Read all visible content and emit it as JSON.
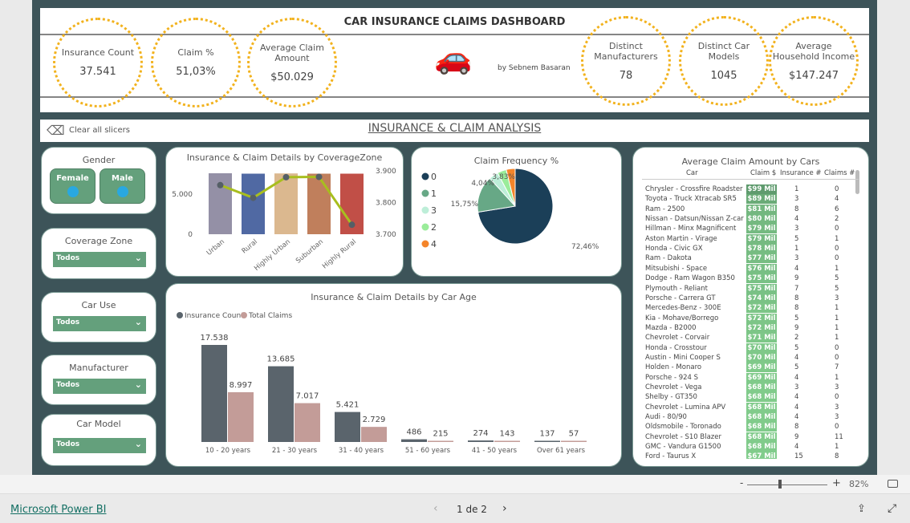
{
  "header": {
    "title": "CAR INSURANCE CLAIMS DASHBOARD",
    "author": "by Sebnem Basaran"
  },
  "kpis": [
    {
      "label": "Insurance Count",
      "value": "37.541"
    },
    {
      "label": "Claim %",
      "value": "51,03%"
    },
    {
      "label": "Average Claim Amount",
      "value": "$50.029"
    },
    {
      "label": "Distinct Manufacturers",
      "value": "78"
    },
    {
      "label": "Distinct Car Models",
      "value": "1045"
    },
    {
      "label": "Average Household Income",
      "value": "$147.247"
    }
  ],
  "slicer_bar": {
    "clear_label": "Clear all slicers",
    "section_title": "INSURANCE & CLAIM ANALYSIS"
  },
  "slicers": {
    "gender": {
      "title": "Gender",
      "options": [
        "Female",
        "Male"
      ]
    },
    "coverage_zone": {
      "title": "Coverage Zone",
      "value": "Todos"
    },
    "car_use": {
      "title": "Car Use",
      "value": "Todos"
    },
    "manufacturer": {
      "title": "Manufacturer",
      "value": "Todos"
    },
    "car_model": {
      "title": "Car Model",
      "value": "Todos"
    }
  },
  "colors": {
    "frame": "#3d5459",
    "accent_green": "#64a07c",
    "kpi_dots": "#f2b21d",
    "line": "#a8be1e"
  },
  "chart_data": [
    {
      "type": "bar+line",
      "title": "Insurance & Claim Details by CoverageZone",
      "categories": [
        "Urban",
        "Rural",
        "Highly Urban",
        "Suburban",
        "Highly Rural"
      ],
      "bar_values": [
        7600,
        7550,
        7580,
        7550,
        7550
      ],
      "bar_colors": [
        "#9490a6",
        "#5069a3",
        "#dbb88f",
        "#c07f5c",
        "#c14f47"
      ],
      "line_values": [
        3.855,
        3.815,
        3.88,
        3.881,
        3.73
      ],
      "y_left_ticks": [
        "0",
        "5.000"
      ],
      "y_left_range": [
        0,
        8000
      ],
      "y_right_ticks": [
        "3.700",
        "3.800",
        "3.900"
      ],
      "y_right_range": [
        3.7,
        3.9
      ]
    },
    {
      "type": "pie",
      "title": "Claim Frequency %",
      "legend": [
        "0",
        "1",
        "3",
        "2",
        "4"
      ],
      "legend_placement": "left",
      "values": [
        72.46,
        15.75,
        4.04,
        3.92,
        3.83
      ],
      "labels": [
        "72,46%",
        "15,75%",
        "4,04%",
        "",
        "3,83%"
      ],
      "colors": [
        "#1b3f58",
        "#67a886",
        "#bdeed8",
        "#9aec9a",
        "#f4852a"
      ]
    },
    {
      "type": "bar",
      "title": "Insurance & Claim Details by Car Age",
      "categories": [
        "10 - 20 years",
        "21 - 30 years",
        "31 - 40 years",
        "51 - 60 years",
        "41 - 50 years",
        "Over 61 years"
      ],
      "series": [
        {
          "name": "Insurance Count",
          "values": [
            17538,
            13685,
            5421,
            486,
            274,
            137
          ],
          "labels": [
            "17.538",
            "13.685",
            "5.421",
            "486",
            "274",
            "137"
          ],
          "color": "#5a646c"
        },
        {
          "name": "Total Claims",
          "values": [
            8997,
            7017,
            2729,
            215,
            143,
            57
          ],
          "labels": [
            "8.997",
            "7.017",
            "2.729",
            "215",
            "143",
            "57"
          ],
          "color": "#c39c98"
        }
      ],
      "legend_placement": "top-left"
    },
    {
      "type": "table",
      "title": "Average Claim Amount by Cars",
      "columns": [
        "Car",
        "Claim $",
        "Insurance #",
        "Claims #"
      ],
      "rows": [
        [
          "Chrysler - Crossfire Roadster",
          "$99 Mil",
          "1",
          "0"
        ],
        [
          "Toyota - Truck Xtracab SR5",
          "$89 Mil",
          "3",
          "4"
        ],
        [
          "Ram - 2500",
          "$81 Mil",
          "8",
          "6"
        ],
        [
          "Nissan - Datsun/Nissan Z-car",
          "$80 Mil",
          "4",
          "2"
        ],
        [
          "Hillman - Minx Magnificent",
          "$79 Mil",
          "3",
          "0"
        ],
        [
          "Aston Martin - Virage",
          "$79 Mil",
          "5",
          "1"
        ],
        [
          "Honda - Civic GX",
          "$78 Mil",
          "1",
          "0"
        ],
        [
          "Ram - Dakota",
          "$77 Mil",
          "3",
          "0"
        ],
        [
          "Mitsubishi - Space",
          "$76 Mil",
          "4",
          "1"
        ],
        [
          "Dodge - Ram Wagon B350",
          "$75 Mil",
          "9",
          "5"
        ],
        [
          "Plymouth - Reliant",
          "$75 Mil",
          "7",
          "5"
        ],
        [
          "Porsche - Carrera GT",
          "$74 Mil",
          "8",
          "3"
        ],
        [
          "Mercedes-Benz - 300E",
          "$72 Mil",
          "8",
          "1"
        ],
        [
          "Kia - Mohave/Borrego",
          "$72 Mil",
          "5",
          "1"
        ],
        [
          "Mazda - B2000",
          "$72 Mil",
          "9",
          "1"
        ],
        [
          "Chevrolet - Corvair",
          "$71 Mil",
          "2",
          "1"
        ],
        [
          "Honda - Crosstour",
          "$70 Mil",
          "5",
          "0"
        ],
        [
          "Austin - Mini Cooper S",
          "$70 Mil",
          "4",
          "0"
        ],
        [
          "Holden - Monaro",
          "$69 Mil",
          "5",
          "7"
        ],
        [
          "Porsche - 924 S",
          "$69 Mil",
          "4",
          "1"
        ],
        [
          "Chevrolet - Vega",
          "$68 Mil",
          "3",
          "3"
        ],
        [
          "Shelby - GT350",
          "$68 Mil",
          "4",
          "0"
        ],
        [
          "Chevrolet - Lumina APV",
          "$68 Mil",
          "4",
          "3"
        ],
        [
          "Audi - 80/90",
          "$68 Mil",
          "4",
          "3"
        ],
        [
          "Oldsmobile - Toronado",
          "$68 Mil",
          "8",
          "0"
        ],
        [
          "Chevrolet - S10 Blazer",
          "$68 Mil",
          "9",
          "11"
        ],
        [
          "GMC - Vandura G1500",
          "$68 Mil",
          "4",
          "1"
        ],
        [
          "Ford - Taurus X",
          "$67 Mil",
          "15",
          "8"
        ]
      ]
    }
  ],
  "footer": {
    "zoom": "82%",
    "zoom_fraction": 0.41,
    "brand": "Microsoft Power BI",
    "page": "1 de 2"
  }
}
